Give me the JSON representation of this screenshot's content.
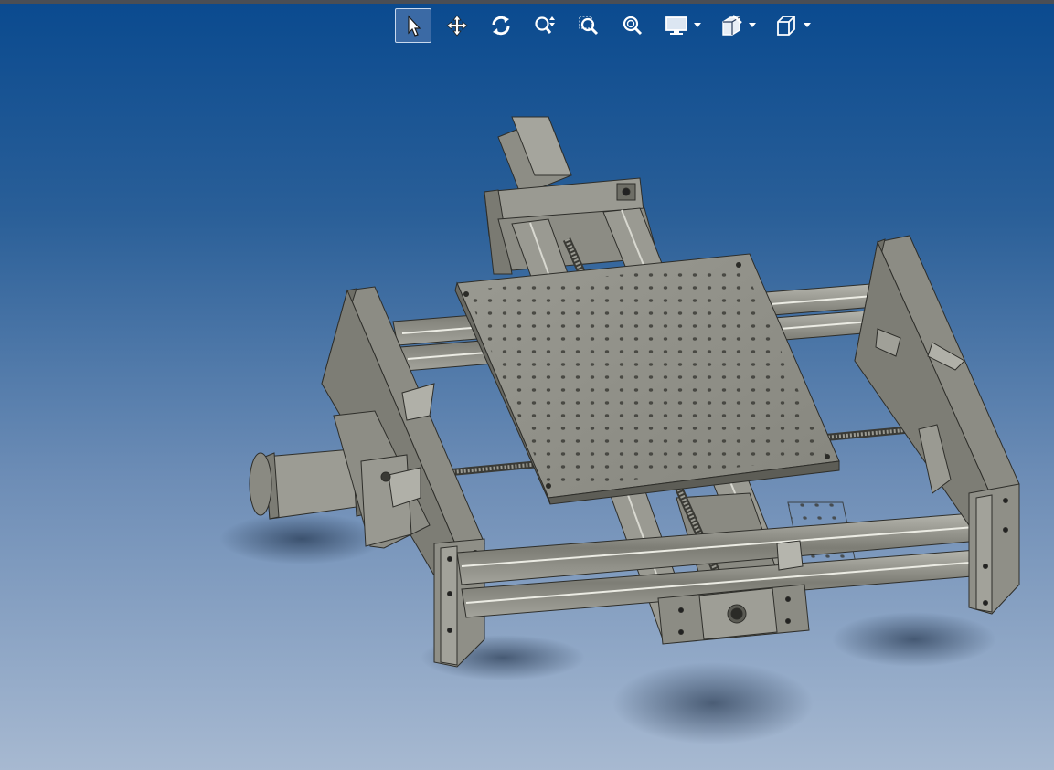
{
  "window": {
    "background_top": "#0a4a8f",
    "background_bottom": "#a7b9d1"
  },
  "toolbar": {
    "tools": [
      {
        "name": "select-tool",
        "icon": "arrow-pointer-icon",
        "active": true
      },
      {
        "name": "pan-tool",
        "icon": "move-arrows-icon",
        "active": false
      },
      {
        "name": "rotate-tool",
        "icon": "rotate-icon",
        "active": false
      },
      {
        "name": "zoom-in-out-tool",
        "icon": "zoom-in-out-icon",
        "active": false
      },
      {
        "name": "zoom-to-area-tool",
        "icon": "zoom-area-icon",
        "active": false
      },
      {
        "name": "zoom-to-fit-tool",
        "icon": "zoom-fit-icon",
        "active": false
      },
      {
        "name": "display-style-tool",
        "icon": "monitor-icon",
        "active": false,
        "has_dropdown": true
      },
      {
        "name": "section-view-tool",
        "icon": "section-view-icon",
        "active": false,
        "has_dropdown": true
      },
      {
        "name": "view-orientation-tool",
        "icon": "cube-icon",
        "active": false,
        "has_dropdown": true
      }
    ]
  },
  "model": {
    "description_icon": "cad-xy-stage-assembly",
    "part_color": "#8e8e86",
    "part_dark": "#55554f",
    "plate_color": "#8a8a82"
  }
}
